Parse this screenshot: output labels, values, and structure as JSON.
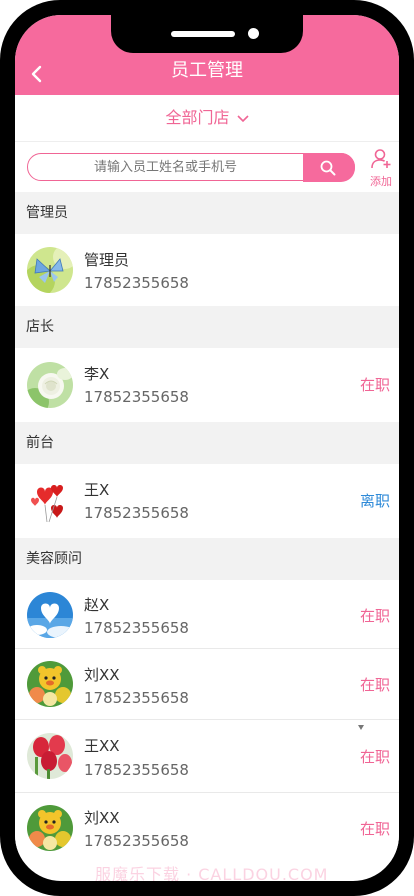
{
  "header": {
    "title": "员工管理"
  },
  "department": {
    "selected": "全部门店"
  },
  "search": {
    "placeholder": "请输入员工姓名或手机号",
    "add_label": "添加"
  },
  "sections": [
    {
      "title": "管理员"
    },
    {
      "title": "店长"
    },
    {
      "title": "前台"
    },
    {
      "title": "美容顾问"
    }
  ],
  "employees": [
    {
      "name": "管理员",
      "phone": "17852355658",
      "status": "",
      "avatar": "butterfly"
    },
    {
      "name": "李X",
      "phone": "17852355658",
      "status": "在职",
      "avatar": "white-rose"
    },
    {
      "name": "王X",
      "phone": "17852355658",
      "status": "离职",
      "avatar": "heart-balloons"
    },
    {
      "name": "赵X",
      "phone": "17852355658",
      "status": "在职",
      "avatar": "sky-heart"
    },
    {
      "name": "刘XX",
      "phone": "17852355658",
      "status": "在职",
      "avatar": "cartoon-bears"
    },
    {
      "name": "王XX",
      "phone": "17852355658",
      "status": "在职",
      "avatar": "red-tulips"
    },
    {
      "name": "刘XX",
      "phone": "17852355658",
      "status": "在职",
      "avatar": "cartoon-bears"
    }
  ],
  "watermark": "服魔乐下载 · CALLDOU.COM",
  "colors": {
    "brand": "#f66a9d",
    "active_status": "#f06595",
    "left_status": "#2e8ad8"
  }
}
